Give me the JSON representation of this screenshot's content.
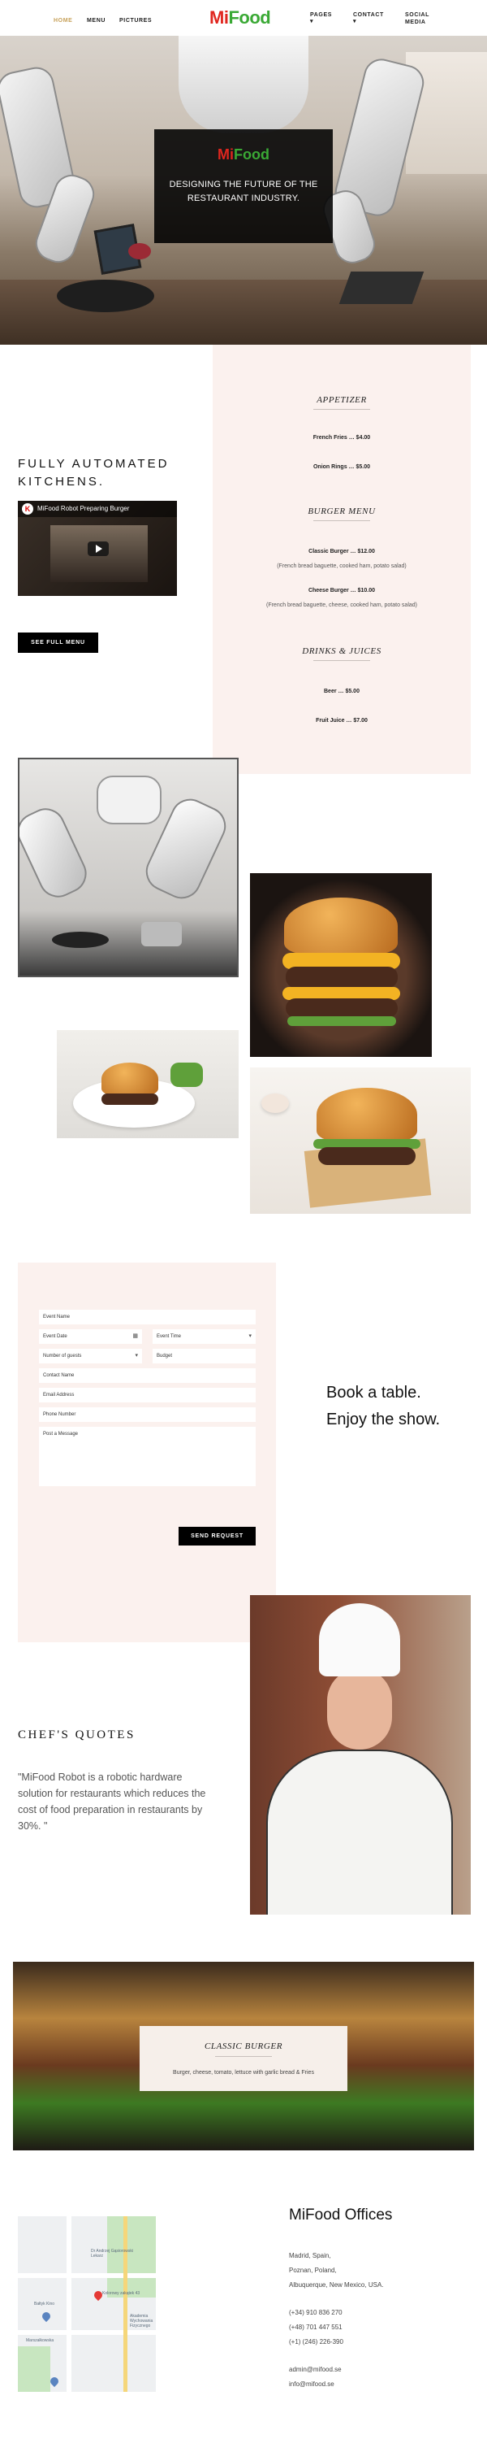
{
  "nav": {
    "home": "HOME",
    "menu": "MENU",
    "pictures": "PICTURES",
    "pages": "PAGES",
    "contact": "CONTACT",
    "social": "SOCIAL MEDIA",
    "caret": "▾",
    "logo_mi": "Mi",
    "logo_food": "Food",
    "active_color": "#c7a15a"
  },
  "hero": {
    "logo_mi": "Mi",
    "logo_food": "Food",
    "subtitle": "DESIGNING THE FUTURE OF THE RESTAURANT INDUSTRY."
  },
  "automated": {
    "title": "FULLY AUTOMATED KITCHENS.",
    "video_title": "MiFood Robot Preparing Burger",
    "video_icon": "K",
    "menu_button": "SEE FULL MENU"
  },
  "menu": {
    "appetizer": "APPETIZER",
    "appetizer_items": [
      "French Fries … $4.00",
      "Onion Rings … $5.00"
    ],
    "burger": "BURGER MENU",
    "burger_items": [
      {
        "name": "Classic Burger … $12.00",
        "desc": "(French bread baguette, cooked ham, potato salad)"
      },
      {
        "name": "Cheese Burger … $10.00",
        "desc": "(French bread baguette, cheese, cooked ham, potato salad)"
      }
    ],
    "drinks": "DRINKS & JUICES",
    "drink_items": [
      "Beer … $5.00",
      "Fruit Juice … $7.00"
    ]
  },
  "booking": {
    "event_name": "Event Name",
    "event_date": "Event Date",
    "event_time": "Event Time",
    "guests": "Number of guests",
    "budget": "Budget",
    "contact_name": "Contact Name",
    "email": "Email Address",
    "phone": "Phone Number",
    "message": "Post a Message",
    "send_button": "SEND REQUEST",
    "calendar_icon": "▦",
    "select_icon": "▾",
    "headline_1": "Book a table.",
    "headline_2": "Enjoy the show."
  },
  "chef": {
    "title": "CHEF'S QUOTES",
    "quote": "\"MiFood Robot is a robotic hardware solution for restaurants which reduces the cost of food preparation in restaurants by 30%. \""
  },
  "banner": {
    "title": "CLASSIC BURGER",
    "desc": "Burger, cheese, tomato, lettuce with garlic bread & Fries"
  },
  "map": {
    "label_1": "Dr Andrzej Gąsiorowski Lekarz",
    "label_2": "Bałtyk Kino",
    "label_3": "Marszałkowska",
    "label_4": "Akademia Wychowania Fizycznego",
    "label_5": "Kolorowy zakątek 43"
  },
  "offices": {
    "title": "MiFood Offices",
    "address_1": "Madrid, Spain,",
    "address_2": "Poznan, Poland,",
    "address_3": "Albuquerque, New Mexico, USA.",
    "phone_1": "(+34) 910 836 270",
    "phone_2": "(+48) 701 447 551",
    "phone_3": "(+1) (246) 226-390",
    "email_1": "admin@mifood.se",
    "email_2": "info@mifood.se"
  }
}
